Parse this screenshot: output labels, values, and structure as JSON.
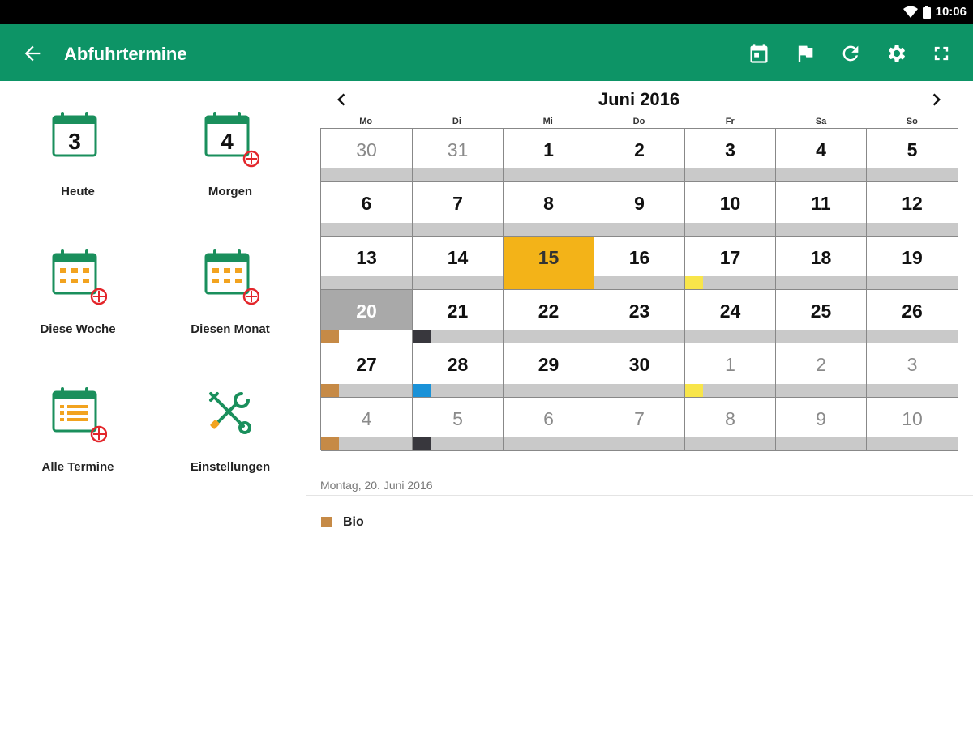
{
  "status_bar": {
    "time": "10:06"
  },
  "app_bar": {
    "title": "Abfuhrtermine"
  },
  "menu": [
    {
      "label": "Heute",
      "day": "3"
    },
    {
      "label": "Morgen",
      "day": "4"
    },
    {
      "label": "Diese Woche"
    },
    {
      "label": "Diesen Monat"
    },
    {
      "label": "Alle Termine"
    },
    {
      "label": "Einstellungen"
    }
  ],
  "calendar": {
    "month_title": "Juni 2016",
    "weekdays": [
      "Mo",
      "Di",
      "Mi",
      "Do",
      "Fr",
      "Sa",
      "So"
    ],
    "today": "15",
    "selected": "20",
    "weeks": [
      [
        "30",
        "31",
        "1",
        "2",
        "3",
        "4",
        "5"
      ],
      [
        "6",
        "7",
        "8",
        "9",
        "10",
        "11",
        "12"
      ],
      [
        "13",
        "14",
        "15",
        "16",
        "17",
        "18",
        "19"
      ],
      [
        "20",
        "21",
        "22",
        "23",
        "24",
        "25",
        "26"
      ],
      [
        "27",
        "28",
        "29",
        "30",
        "1",
        "2",
        "3"
      ],
      [
        "4",
        "5",
        "6",
        "7",
        "8",
        "9",
        "10"
      ]
    ],
    "markers": [
      {
        "week": 2,
        "day": 4,
        "color": "#f8e54a"
      },
      {
        "week": 3,
        "day": 0,
        "color": "#c68a46"
      },
      {
        "week": 3,
        "day": 1,
        "color": "#38373d"
      },
      {
        "week": 4,
        "day": 0,
        "color": "#c68a46"
      },
      {
        "week": 4,
        "day": 1,
        "color": "#1a92d8"
      },
      {
        "week": 4,
        "day": 4,
        "color": "#f8e54a"
      },
      {
        "week": 5,
        "day": 0,
        "color": "#c68a46"
      },
      {
        "week": 5,
        "day": 1,
        "color": "#38373d"
      }
    ]
  },
  "detail": {
    "date": "Montag, 20. Juni 2016",
    "items": [
      {
        "label": "Bio",
        "color": "#c68a46"
      }
    ]
  },
  "colors": {
    "accent": "#0d9466",
    "today": "#f3b318",
    "selected": "#a9a9a9"
  }
}
